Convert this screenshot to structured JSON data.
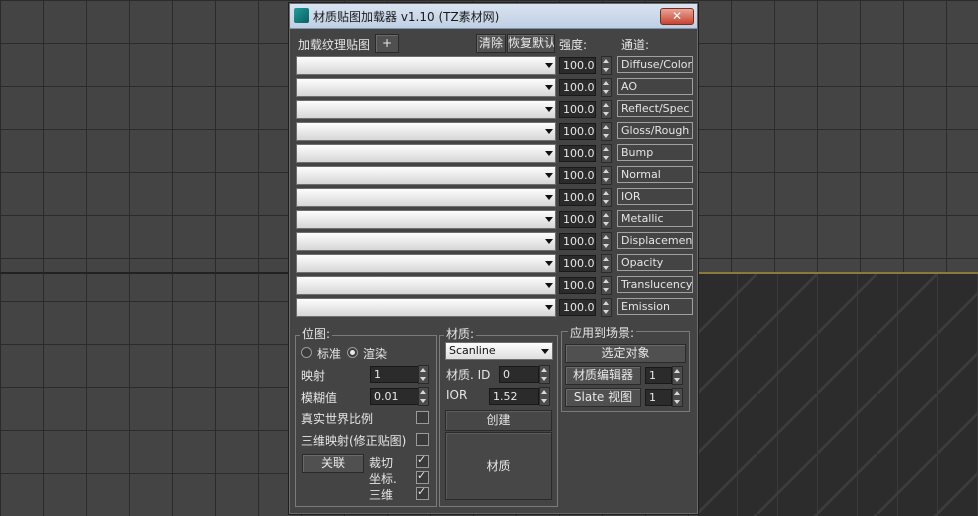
{
  "window": {
    "title": "材质贴图加载器 v1.10 (TZ素材网)",
    "close_glyph": "✕"
  },
  "toolbar": {
    "load_label": "加载纹理贴图",
    "add_label": "+",
    "clear_label": "清除",
    "reset_label": "恢复默认",
    "strength_header": "强度:",
    "channel_header": "通道:"
  },
  "rows": [
    {
      "value": "100.0",
      "channel": "Diffuse/Color"
    },
    {
      "value": "100.0",
      "channel": "AO"
    },
    {
      "value": "100.0",
      "channel": "Reflect/Spec"
    },
    {
      "value": "100.0",
      "channel": "Gloss/Rough"
    },
    {
      "value": "100.0",
      "channel": "Bump"
    },
    {
      "value": "100.0",
      "channel": "Normal"
    },
    {
      "value": "100.0",
      "channel": "IOR"
    },
    {
      "value": "100.0",
      "channel": "Metallic"
    },
    {
      "value": "100.0",
      "channel": "Displacement"
    },
    {
      "value": "100.0",
      "channel": "Opacity"
    },
    {
      "value": "100.0",
      "channel": "Translucency"
    },
    {
      "value": "100.0",
      "channel": "Emission"
    }
  ],
  "bitmap": {
    "title": "位图:",
    "standard_label": "标准",
    "render_label": "渲染",
    "mapping_label": "映射",
    "mapping_value": "1",
    "blur_label": "模糊值",
    "blur_value": "0.01",
    "realworld_label": "真实世界比例",
    "map3d_label": "三维映射(修正贴图)",
    "relate_label": "关联",
    "crop_label": "裁切",
    "coord_label": "坐标.",
    "threed_label": "三维"
  },
  "material": {
    "title": "材质:",
    "type_value": "Scanline",
    "id_label": "材质. ID",
    "id_value": "0",
    "ior_label": "IOR",
    "ior_value": "1.52",
    "create_label": "创建",
    "preview_label": "材质"
  },
  "scene": {
    "title": "应用到场景:",
    "select_label": "选定对象",
    "editor_label": "材质编辑器",
    "editor_value": "1",
    "slate_label": "Slate 视图",
    "slate_value": "1"
  }
}
